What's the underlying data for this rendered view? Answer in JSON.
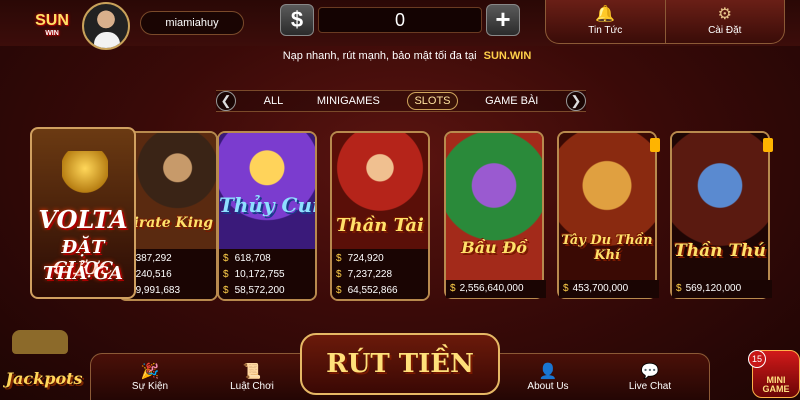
{
  "header": {
    "logo_text": "SUN",
    "logo_sub": "WIN",
    "username": "miamiahuy",
    "currency_symbol": "$",
    "balance": "0",
    "plus_label": "+",
    "news_label": "Tin Tức",
    "settings_label": "Cài Đặt"
  },
  "announcement": {
    "text": "Nạp nhanh, rút mạnh, bảo mật tối đa tại",
    "brand": "SUN.WIN"
  },
  "tabs": {
    "prev": "❮",
    "next": "❯",
    "items": [
      "ALL",
      "MINIGAMES",
      "SLOTS",
      "GAME BÀI"
    ],
    "active": "SLOTS"
  },
  "promo": {
    "line1": "VOLTA",
    "line2": "ĐẶT CƯỢC",
    "line3": "THẢ GA"
  },
  "games": [
    {
      "title": "Pirate King",
      "jackpots": [
        "387,292",
        "240,516",
        "9,991,683"
      ]
    },
    {
      "title": "Thủy Cung",
      "jackpots": [
        "618,708",
        "10,172,755",
        "58,572,200"
      ]
    },
    {
      "title": "Thần Tài",
      "jackpots": [
        "724,920",
        "7,237,228",
        "64,552,866"
      ]
    },
    {
      "title": "Bầu Đồ",
      "jackpots": [
        "2,556,640,000"
      ]
    },
    {
      "title": "Tây Du Thần Khí",
      "jackpots": [
        "453,700,000"
      ]
    },
    {
      "title": "Thần Thú",
      "jackpots": [
        "569,120,000"
      ]
    }
  ],
  "currency": "$",
  "bottom": {
    "events_label": "Sự Kiện",
    "rules_label": "Luật Chơi",
    "withdraw_label": "RÚT TIỀN",
    "about_label": "About Us",
    "chat_label": "Live Chat",
    "jackpots_logo": "Jackpots",
    "minigame_label": "MINI GAME",
    "minigame_badge": "15"
  }
}
